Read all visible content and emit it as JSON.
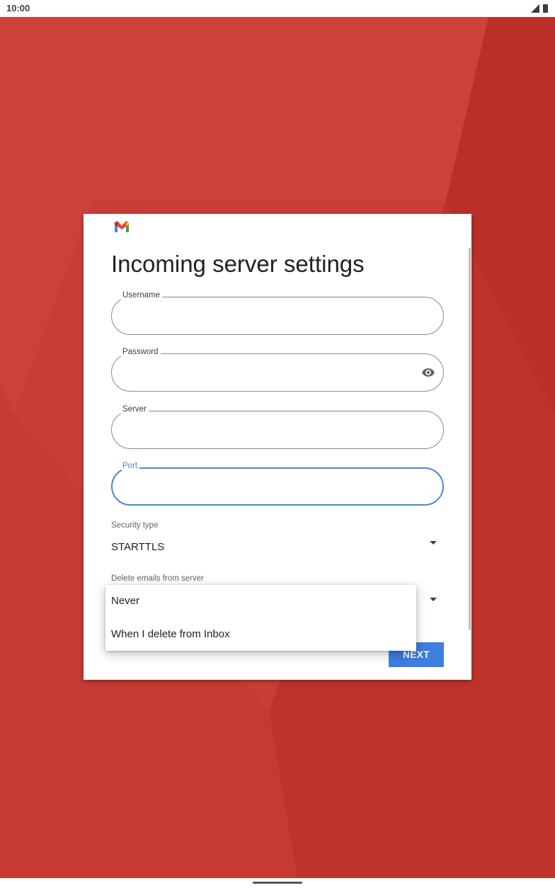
{
  "status_bar": {
    "time": "10:00"
  },
  "dialog": {
    "title": "Incoming server settings",
    "fields": {
      "username": {
        "label": "Username",
        "value": ""
      },
      "password": {
        "label": "Password",
        "value": ""
      },
      "server": {
        "label": "Server",
        "value": ""
      },
      "port": {
        "label": "Port",
        "value": ""
      }
    },
    "security_type": {
      "label": "Security type",
      "value": "STARTTLS"
    },
    "delete_emails": {
      "label": "Delete emails from server"
    },
    "next_label": "NEXT"
  },
  "popup_menu": {
    "items": [
      {
        "label": "Never"
      },
      {
        "label": "When I delete from Inbox"
      }
    ]
  },
  "colors": {
    "wallpaper": "#c93d35",
    "accent": "#4a86d6",
    "button": "#3f7de0"
  },
  "icons": [
    "gmail-logo",
    "eye-icon",
    "signal-icon",
    "battery-icon",
    "dropdown-arrow-icon"
  ]
}
